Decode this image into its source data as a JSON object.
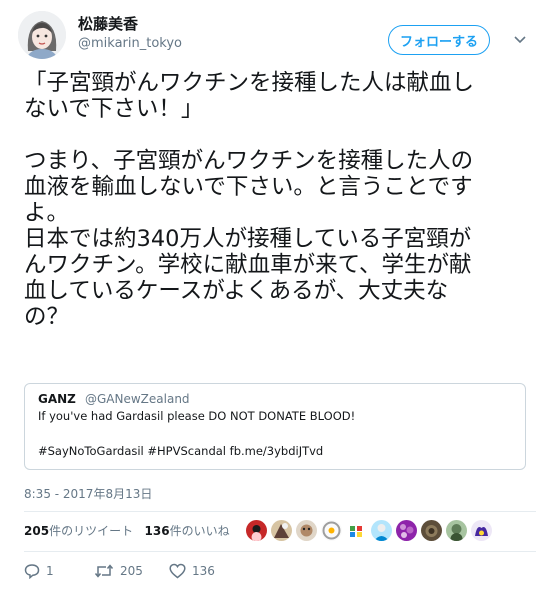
{
  "user": {
    "display_name": "松藤美香",
    "handle": "@mikarin_tokyo",
    "follow_label": "フォローする"
  },
  "tweet": {
    "lines": [
      "「子宮頸がんワクチンを接種した人は献血し",
      "ないで下さい！」",
      "",
      "つまり、子宮頸がんワクチンを接種した人の",
      "血液を輸血しないで下さい。と言うことです",
      "よ。",
      "日本では約340万人が接種している子宮頸が",
      "んワクチン。学校に献血車が来て、学生が献",
      "血しているケースがよくあるが、大丈夫な",
      "の？"
    ]
  },
  "quote": {
    "name": "GANZ",
    "handle": "@GANewZealand",
    "line1": "If you've had Gardasil please DO NOT DONATE BLOOD!",
    "line2": "#SayNoToGardasil #HPVScandal fb.me/3ybdiJTvd"
  },
  "timestamp": "8:35 - 2017年8月13日",
  "stats": {
    "retweets_count": "205",
    "retweets_label": "件のリツイート",
    "likes_count": "136",
    "likes_label": "件のいいね"
  },
  "actions": {
    "replies": "1",
    "retweets": "205",
    "likes": "136"
  },
  "colors": {
    "accent": "#1da1f2",
    "secondary_text": "#657786",
    "border": "#ccd6dd"
  }
}
